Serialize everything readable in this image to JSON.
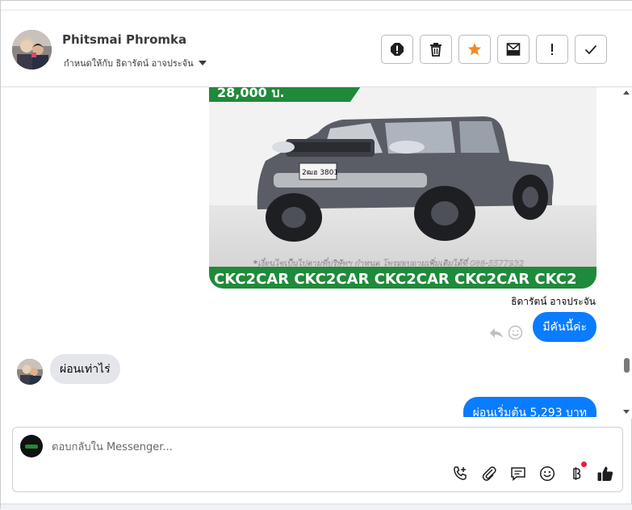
{
  "colors": {
    "accent": "#0a7cff",
    "incoming_bubble": "#e4e6eb",
    "star": "#f38b26",
    "notification_dot": "#e41e3f"
  },
  "header": {
    "contact_name": "Phitsmai Phromka",
    "assigned_to": "กำหนดให้กับ ธิดารัตน์ อาจประจัน",
    "actions": [
      {
        "name": "spam-icon",
        "label": "!"
      },
      {
        "name": "trash-icon",
        "label": ""
      },
      {
        "name": "star-icon",
        "label": ""
      },
      {
        "name": "mark-unread-icon",
        "label": ""
      },
      {
        "name": "follow-up-icon",
        "label": "!"
      },
      {
        "name": "check-icon",
        "label": ""
      }
    ]
  },
  "thread": {
    "image": {
      "plate": "2ฒฮ 3801",
      "price_fragment": "28,000 บ.",
      "phone_line": "*เงื่อนไขเป็นไปตามที่บริษัทฯ กำหนด โทรสอบถามเพิ่มเติมได้ที่ 088-5577932",
      "banner": "CKC2CAR CKC2CAR CKC2CAR CKC2CAR CKC2"
    },
    "sender_label": "ธิดารัตน์ อาจประจัน",
    "messages": [
      {
        "direction": "out",
        "text": "มีคันนี้ค่ะ"
      },
      {
        "direction": "in",
        "text": "ผ่อนเท่าไร่"
      },
      {
        "direction": "out",
        "text": "ผ่อนเริ่มต้น 5,293 บาท"
      }
    ]
  },
  "composer": {
    "placeholder": "ตอบกลับใน Messenger...",
    "tools": [
      "add-call-icon",
      "attachment-icon",
      "saved-reply-icon",
      "emoji-icon",
      "currency-icon",
      "like-icon"
    ]
  }
}
